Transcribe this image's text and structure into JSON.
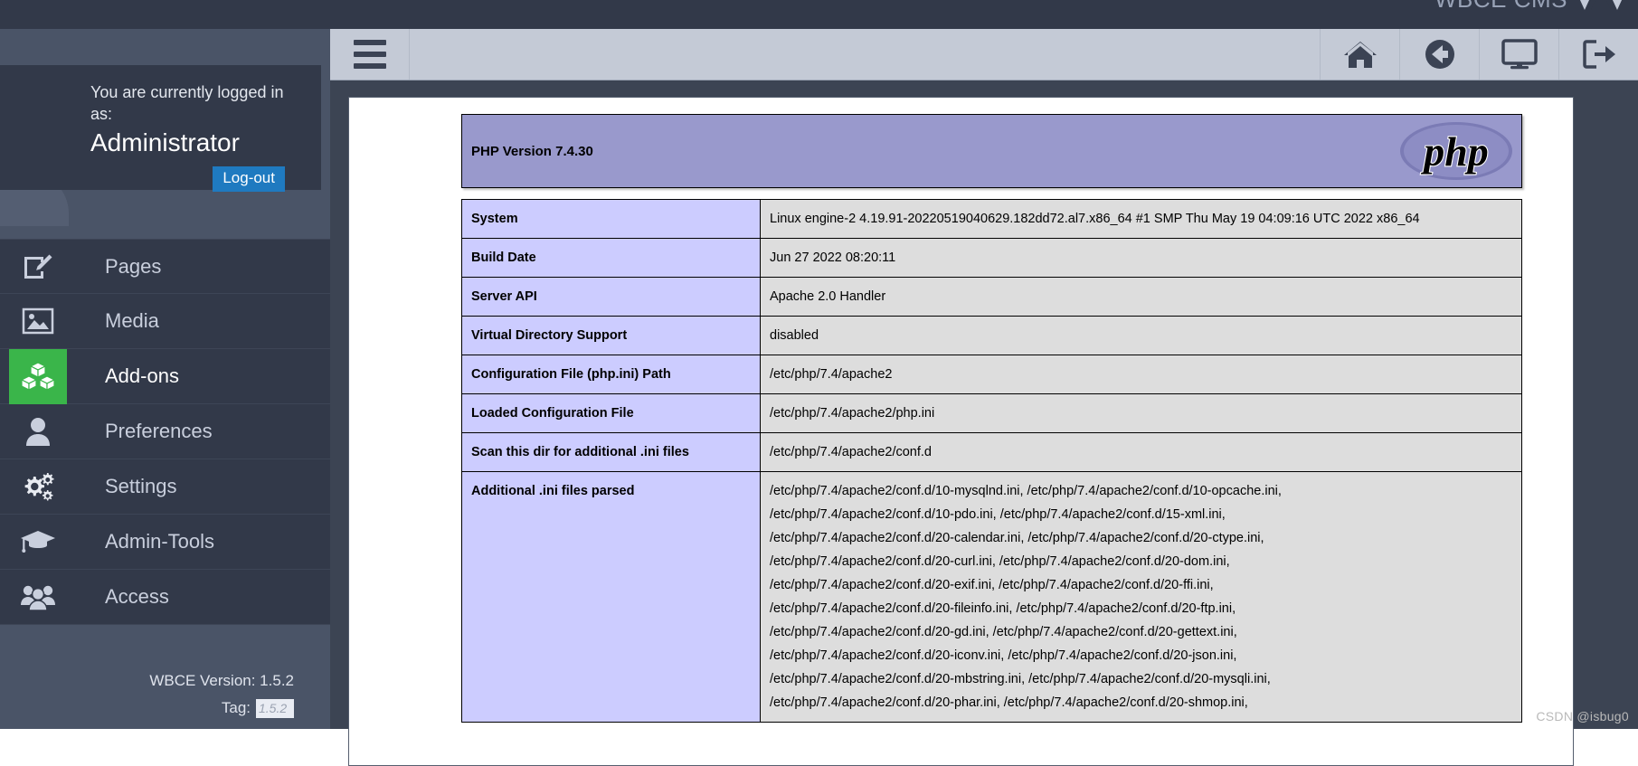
{
  "brand": {
    "title": "WBCE CMS",
    "logo_icon": "wbce-triangles-logo"
  },
  "sidebar": {
    "user": {
      "greeting": "You are currently logged in as:",
      "name": "Administrator",
      "logout_label": "Log-out"
    },
    "items": [
      {
        "label": "Pages",
        "icon": "page-edit-icon",
        "active": false
      },
      {
        "label": "Media",
        "icon": "image-icon",
        "active": false
      },
      {
        "label": "Add-ons",
        "icon": "blocks-icon",
        "active": true
      },
      {
        "label": "Preferences",
        "icon": "user-icon",
        "active": false
      },
      {
        "label": "Settings",
        "icon": "gears-icon",
        "active": false
      },
      {
        "label": "Admin-Tools",
        "icon": "graduation-cap-icon",
        "active": false
      },
      {
        "label": "Access",
        "icon": "users-group-icon",
        "active": false
      }
    ],
    "footer": {
      "version_label": "WBCE Version: 1.5.2",
      "tag_label": "Tag:",
      "tag_value": "1.5.2"
    }
  },
  "toolbar": {
    "menu_icon": "hamburger-icon",
    "buttons": [
      {
        "icon": "home-icon",
        "name": "home-button"
      },
      {
        "icon": "back-circle-icon",
        "name": "back-button"
      },
      {
        "icon": "monitor-icon",
        "name": "view-site-button"
      },
      {
        "icon": "logout-arrow-icon",
        "name": "logout-button"
      }
    ]
  },
  "phpinfo": {
    "version_title": "PHP Version 7.4.30",
    "logo_icon": "php-elephant-logo",
    "rows": [
      {
        "key": "System",
        "lines": [
          "Linux engine-2 4.19.91-20220519040629.182dd72.al7.x86_64 #1 SMP Thu May 19 04:09:16 UTC 2022 x86_64"
        ]
      },
      {
        "key": "Build Date",
        "lines": [
          "Jun 27 2022 08:20:11"
        ]
      },
      {
        "key": "Server API",
        "lines": [
          "Apache 2.0 Handler"
        ]
      },
      {
        "key": "Virtual Directory Support",
        "lines": [
          "disabled"
        ]
      },
      {
        "key": "Configuration File (php.ini) Path",
        "lines": [
          "/etc/php/7.4/apache2"
        ]
      },
      {
        "key": "Loaded Configuration File",
        "lines": [
          "/etc/php/7.4/apache2/php.ini"
        ]
      },
      {
        "key": "Scan this dir for additional .ini files",
        "lines": [
          "/etc/php/7.4/apache2/conf.d"
        ]
      },
      {
        "key": "Additional .ini files parsed",
        "lines": [
          "/etc/php/7.4/apache2/conf.d/10-mysqlnd.ini, /etc/php/7.4/apache2/conf.d/10-opcache.ini,",
          "/etc/php/7.4/apache2/conf.d/10-pdo.ini, /etc/php/7.4/apache2/conf.d/15-xml.ini,",
          "/etc/php/7.4/apache2/conf.d/20-calendar.ini, /etc/php/7.4/apache2/conf.d/20-ctype.ini,",
          "/etc/php/7.4/apache2/conf.d/20-curl.ini, /etc/php/7.4/apache2/conf.d/20-dom.ini,",
          "/etc/php/7.4/apache2/conf.d/20-exif.ini, /etc/php/7.4/apache2/conf.d/20-ffi.ini,",
          "/etc/php/7.4/apache2/conf.d/20-fileinfo.ini, /etc/php/7.4/apache2/conf.d/20-ftp.ini,",
          "/etc/php/7.4/apache2/conf.d/20-gd.ini, /etc/php/7.4/apache2/conf.d/20-gettext.ini,",
          "/etc/php/7.4/apache2/conf.d/20-iconv.ini, /etc/php/7.4/apache2/conf.d/20-json.ini,",
          "/etc/php/7.4/apache2/conf.d/20-mbstring.ini, /etc/php/7.4/apache2/conf.d/20-mysqli.ini,",
          "/etc/php/7.4/apache2/conf.d/20-phar.ini, /etc/php/7.4/apache2/conf.d/20-shmop.ini,"
        ]
      }
    ]
  },
  "watermark": "CSDN @isbug0",
  "colors": {
    "topbar": "#323949",
    "sidebar": "#4a5467",
    "nav_item": "#323949",
    "accent_green": "#3ab54a",
    "logout_blue": "#1f7ac0",
    "toolbar": "#c4cad6",
    "php_header": "#9999cc",
    "php_key": "#ccccff",
    "php_value": "#dddddd"
  }
}
